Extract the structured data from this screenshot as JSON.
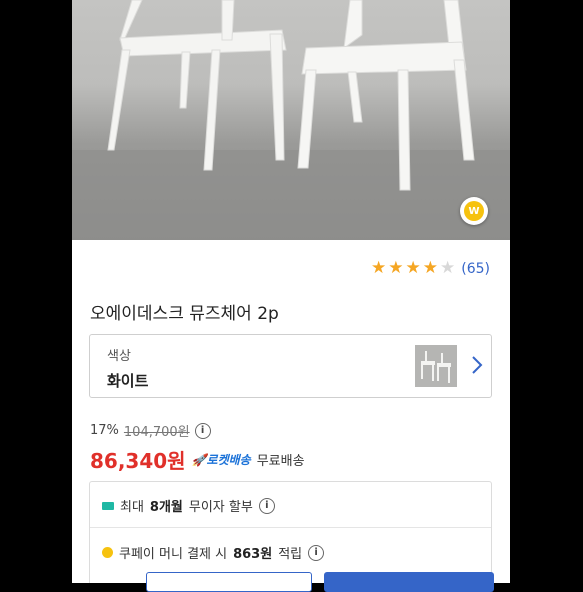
{
  "product": {
    "rating_count": "(65)",
    "rating_stars": 4,
    "title": "오에이데스크 뮤즈체어 2p"
  },
  "option": {
    "label": "색상",
    "value": "화이트"
  },
  "pricing": {
    "discount_percent": "17%",
    "original_price": "104,700원",
    "sale_price": "86,340원",
    "rocket_label": "로켓배송",
    "shipping": "무료배송",
    "price_color": "#e0302a"
  },
  "benefits": {
    "installment_prefix": "최대",
    "installment_bold": "8개월",
    "installment_suffix": "무이자 할부",
    "coupay_prefix": "쿠페이 머니 결제 시",
    "coupay_bold": "863원",
    "coupay_suffix": "적립"
  },
  "badge": {
    "letter": "W"
  },
  "icons": {
    "info": "i"
  }
}
